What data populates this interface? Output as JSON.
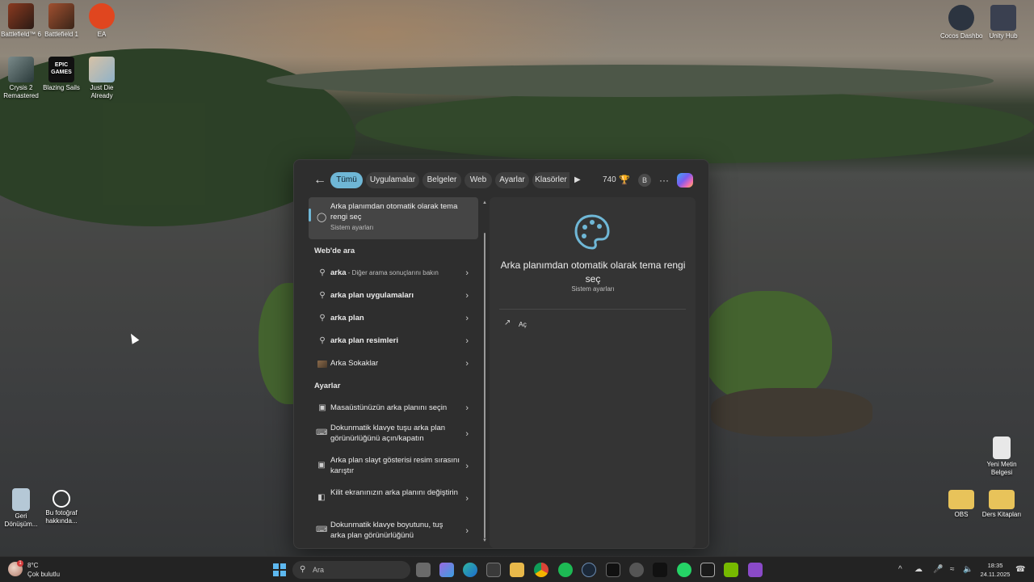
{
  "desktop": {
    "icons_left": [
      {
        "label": "Battlefield™ 6"
      },
      {
        "label": "Battlefield 1"
      },
      {
        "label": "EA"
      },
      {
        "label": "Crysis 2 Remastered"
      },
      {
        "label": "Blazing Sails"
      },
      {
        "label": "Just Die Already"
      }
    ],
    "icons_right_top": [
      {
        "label": "Cocos Dashboard"
      },
      {
        "label": "Unity Hub"
      }
    ],
    "icons_bottom_left": [
      {
        "label": "Geri Dönüşüm..."
      },
      {
        "label": "Bu fotoğraf hakkında..."
      }
    ],
    "icons_bottom_right": [
      {
        "label": "Yeni Metin Belgesi"
      },
      {
        "label": "OBS"
      },
      {
        "label": "Ders Kitapları"
      }
    ],
    "epic_logo_text": "EPIC GAMES"
  },
  "search": {
    "tabs": [
      {
        "label": "Tümü",
        "active": true
      },
      {
        "label": "Uygulamalar"
      },
      {
        "label": "Belgeler"
      },
      {
        "label": "Web"
      },
      {
        "label": "Ayarlar"
      },
      {
        "label": "Klasörler"
      }
    ],
    "points": "740",
    "avatar_letter": "B",
    "best_match": {
      "title": "Arka planımdan otomatik olarak tema rengi seç",
      "subtitle": "Sistem ayarları"
    },
    "web_section": "Web'de ara",
    "web_results": [
      {
        "bold": "arka",
        "rest": " - Diğer arama sonuçlarını bakın"
      },
      {
        "bold": "arka plan uygulamaları",
        "rest": ""
      },
      {
        "bold": "arka plan",
        "rest": ""
      },
      {
        "bold": "arka plan resimleri",
        "rest": ""
      },
      {
        "bold": "Arka Sokaklar",
        "rest": ""
      }
    ],
    "settings_section": "Ayarlar",
    "settings_results": [
      {
        "label": "Masaüstünüzün arka planını seçin"
      },
      {
        "label": "Dokunmatik klavye tuşu arka plan görünürlüğünü açın/kapatın"
      },
      {
        "label": "Arka plan slayt gösterisi resim sırasını karıştır"
      },
      {
        "label": "Kilit ekranınızın arka planını değiştirin"
      },
      {
        "label": "Dokunmatik klavye boyutunu, tuş arka plan görünürlüğünü"
      }
    ],
    "preview": {
      "title": "Arka planımdan otomatik olarak tema rengi seç",
      "subtitle": "Sistem ayarları",
      "open_label": "Aç"
    },
    "accent_color": "#6fb7d6"
  },
  "taskbar": {
    "weather_temp": "8°C",
    "weather_condition": "Çok bulutlu",
    "weather_badge": "1",
    "search_placeholder": "Ara",
    "time": "18:35",
    "date": "24.11.2025"
  }
}
